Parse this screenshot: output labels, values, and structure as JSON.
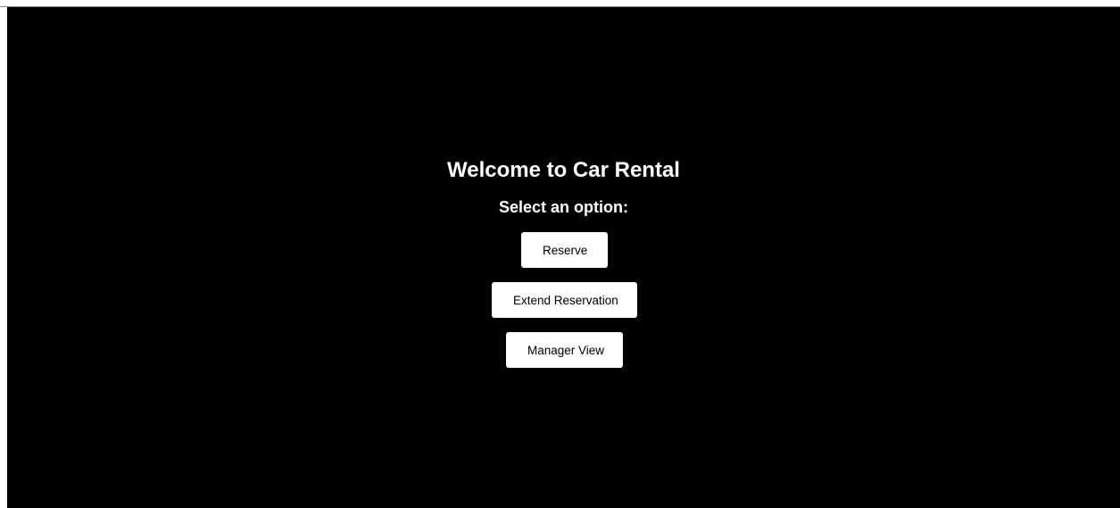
{
  "page": {
    "title": "Welcome to Car Rental",
    "subtitle": "Select an option:"
  },
  "options": {
    "reserve_label": "Reserve",
    "extend_label": "Extend Reservation",
    "manager_label": "Manager View"
  },
  "colors": {
    "background": "#000000",
    "text": "#ffffff",
    "button_background": "#ffffff",
    "button_text": "#000000"
  }
}
